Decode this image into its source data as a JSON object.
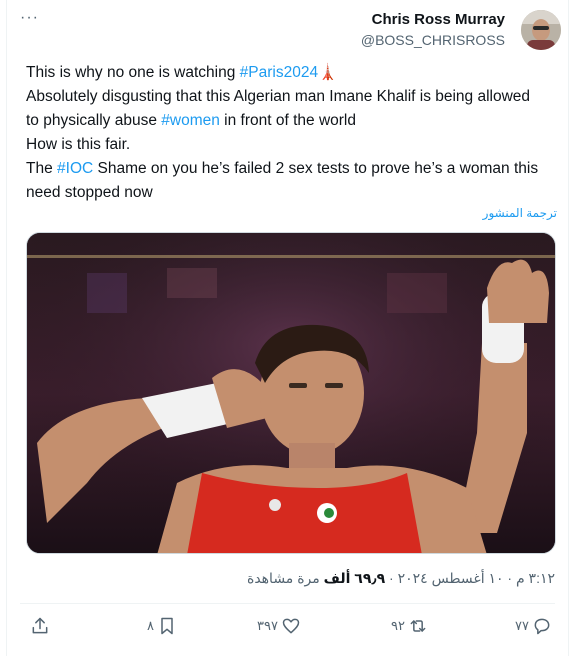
{
  "header": {
    "more_label": "···",
    "display_name": "Chris Ross Murray",
    "handle": "@BOSS_CHRISROSS"
  },
  "tweet": {
    "line1_pre": "This is why no one is watching ",
    "line1_tag": "#Paris2024",
    "line1_emoji": "🗼",
    "line2": "Absolutely disgusting that this Algerian man Imane Khalif is being allowed",
    "line3_pre": "to physically abuse ",
    "line3_tag": "#women",
    "line3_post": " in front of the world",
    "line4": "How is this fair.",
    "line5_pre": "The ",
    "line5_tag": "#IOC",
    "line5_post": " Shame on you he’s failed 2 sex tests to prove he’s a woman this",
    "line6": "need stopped now"
  },
  "translate_label": "ترجمة المنشور",
  "meta": {
    "time_date": "٣:١٢ م · ١٠ أغسطس ٢٠٢٤ · ",
    "views_count": "٦٩٫٩ ألف",
    "views_label": " مرة مشاهدة"
  },
  "actions": {
    "reply_count": "٧٧",
    "retweet_count": "٩٢",
    "like_count": "٣٩٧",
    "bookmark_count": "٨",
    "icons": [
      "reply-icon",
      "retweet-icon",
      "like-icon",
      "bookmark-icon",
      "share-icon"
    ]
  },
  "colors": {
    "accent": "#1d9bf0",
    "text": "#0f1419",
    "secondary": "#536471",
    "jersey": "#d62a1f"
  }
}
